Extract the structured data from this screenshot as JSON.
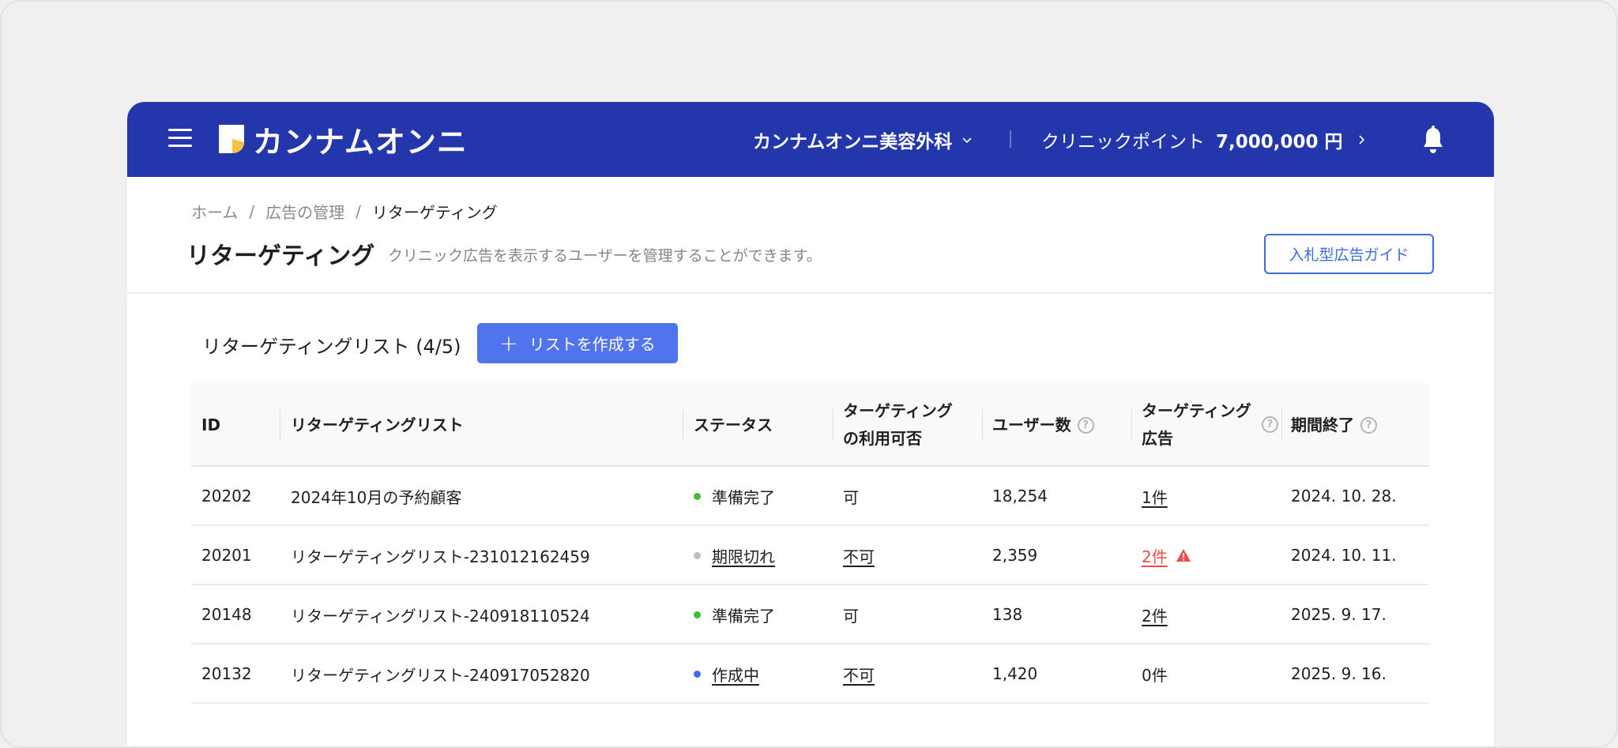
{
  "header": {
    "logo_text": "カンナムオンニ",
    "clinic_name": "カンナムオンニ美容外科",
    "points_label": "クリニックポイント",
    "points_value": "7,000,000 円",
    "brand_color": "#2336ab"
  },
  "breadcrumb": {
    "items": [
      "ホーム",
      "広告の管理",
      "リターゲティング"
    ],
    "separator": "/"
  },
  "page": {
    "title": "リターゲティング",
    "description": "クリニック広告を表示するユーザーを管理することができます。",
    "guide_button": "入札型広告ガイド"
  },
  "list": {
    "title": "リターゲティングリスト (4/5)",
    "create_button": "リストを作成する",
    "accent_color": "#4f74ee"
  },
  "table": {
    "columns": {
      "id": "ID",
      "name": "リターゲティングリスト",
      "status": "ステータス",
      "availability_line1": "ターゲティング",
      "availability_line2": "の利用可否",
      "users": "ユーザー数",
      "ads_line1": "ターゲティング",
      "ads_line2": "広告",
      "expiry": "期間終了",
      "help_glyph": "?"
    },
    "rows": [
      {
        "id": "20202",
        "name": "2024年10月の予約顧客",
        "status": "準備完了",
        "status_color": "#3fbf2f",
        "status_link": false,
        "availability": "可",
        "availability_link": false,
        "users": "18,254",
        "ads": "1件",
        "ads_link": true,
        "ads_warning": false,
        "expiry": "2024. 10. 28."
      },
      {
        "id": "20201",
        "name": "リターゲティングリスト-231012162459",
        "status": "期限切れ",
        "status_color": "#bdbdbd",
        "status_link": true,
        "availability": "不可",
        "availability_link": true,
        "users": "2,359",
        "ads": "2件",
        "ads_link": true,
        "ads_warning": true,
        "expiry": "2024. 10. 11."
      },
      {
        "id": "20148",
        "name": "リターゲティングリスト-240918110524",
        "status": "準備完了",
        "status_color": "#3fbf2f",
        "status_link": false,
        "availability": "可",
        "availability_link": false,
        "users": "138",
        "ads": "2件",
        "ads_link": true,
        "ads_warning": false,
        "expiry": "2025. 9. 17."
      },
      {
        "id": "20132",
        "name": "リターゲティングリスト-240917052820",
        "status": "作成中",
        "status_color": "#3d6be0",
        "status_link": true,
        "availability": "不可",
        "availability_link": true,
        "users": "1,420",
        "ads": "0件",
        "ads_link": false,
        "ads_warning": false,
        "expiry": "2025. 9. 16."
      }
    ]
  },
  "icons": {
    "menu": "hamburger-icon",
    "logo": "logo-mark-icon",
    "clinic_chevron": "chevron-down-icon",
    "points_chevron": "chevron-right-icon",
    "bell": "bell-icon",
    "plus": "plus-icon",
    "help": "help-circle-icon",
    "warning": "warning-triangle-icon"
  }
}
